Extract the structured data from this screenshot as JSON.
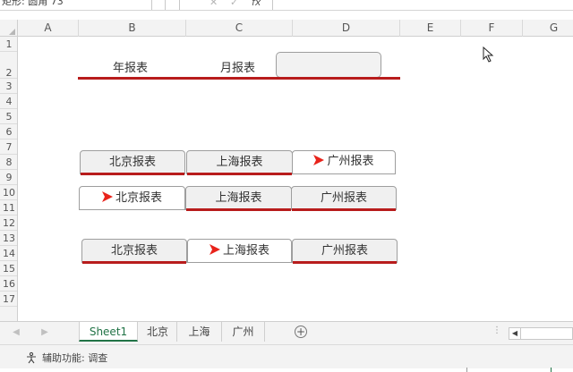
{
  "formula_bar": {
    "name_box": "矩形: 圆角 73",
    "cancel_glyph": "✕",
    "enter_glyph": "✓",
    "fx_glyph": "fx",
    "formula": ""
  },
  "columns": [
    "A",
    "B",
    "C",
    "D",
    "E",
    "F",
    "G"
  ],
  "rows": [
    "1",
    "2",
    "3",
    "4",
    "5",
    "6",
    "7",
    "8",
    "9",
    "10",
    "11",
    "12",
    "13",
    "14",
    "15",
    "16",
    "17"
  ],
  "row1": {
    "label_year": "年报表",
    "label_month": "月报表",
    "box_text": ""
  },
  "group1": {
    "tabs": [
      "北京报表",
      "上海报表",
      "广州报表"
    ],
    "active": "广州报表"
  },
  "group2": {
    "tabs": [
      "北京报表",
      "上海报表",
      "广州报表"
    ],
    "active": "北京报表"
  },
  "group3": {
    "tabs": [
      "北京报表",
      "上海报表",
      "广州报表"
    ],
    "active": "上海报表"
  },
  "sheet_tabs": [
    "Sheet1",
    "北京",
    "上海",
    "广州"
  ],
  "active_sheet": "Sheet1",
  "add_sheet_glyph": "+",
  "nav_prev": "◀",
  "nav_next": "▶",
  "status": {
    "accessibility": "辅助功能: 调查"
  },
  "colors": {
    "accent_red": "#b81c1c",
    "arrow_red": "#e8231b",
    "excel_green": "#217346"
  }
}
